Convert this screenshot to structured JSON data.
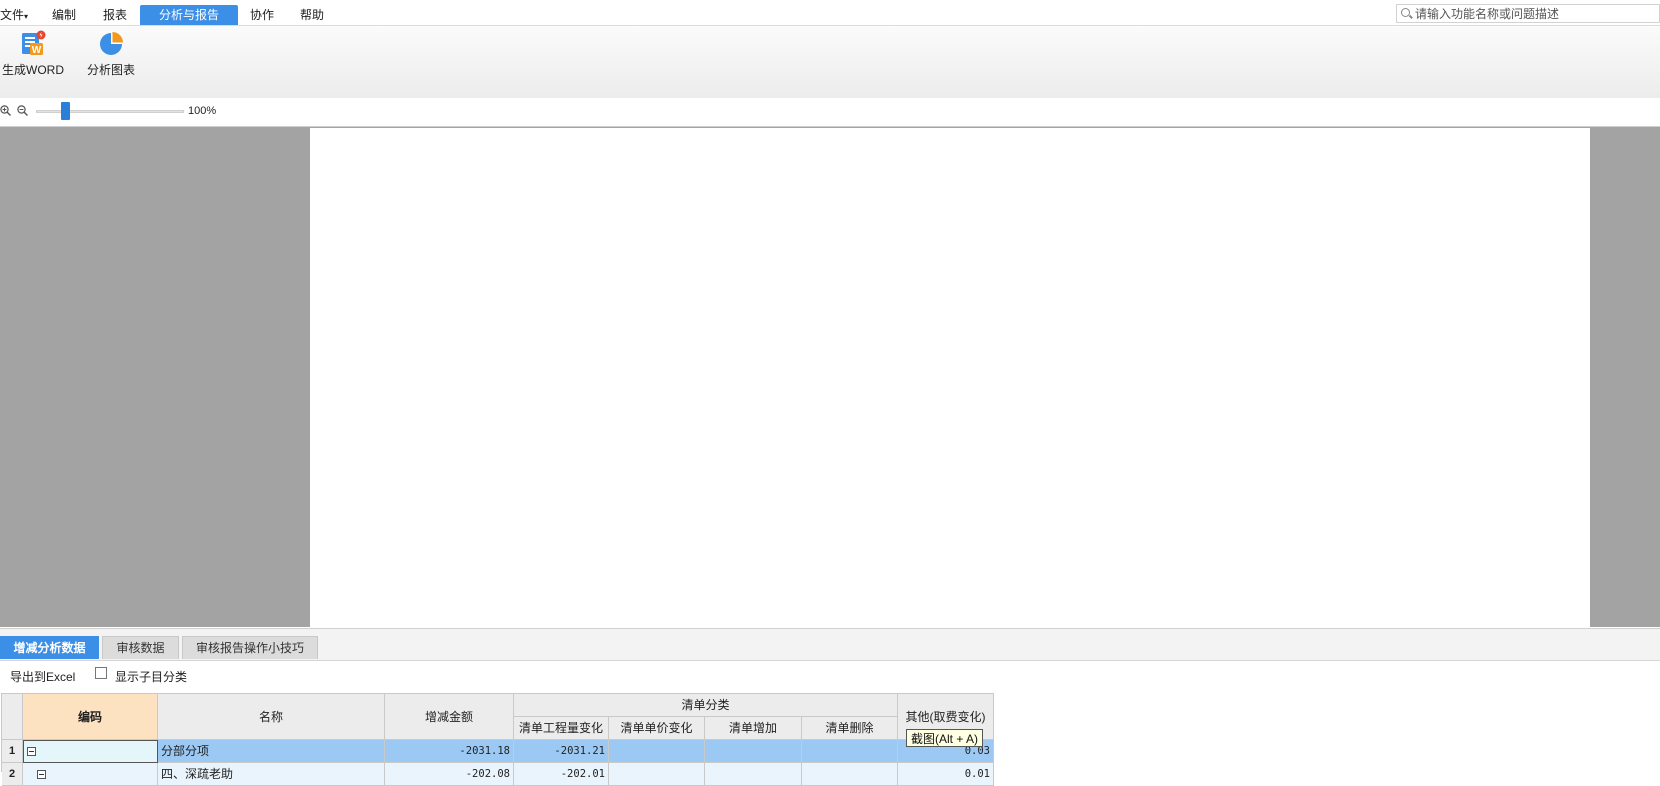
{
  "menu": {
    "file": "文件",
    "edit": "编制",
    "report": "报表",
    "analysis": "分析与报告",
    "collab": "协作",
    "help": "帮助"
  },
  "search": {
    "placeholder": "请输入功能名称或问题描述"
  },
  "ribbon": {
    "word": "生成WORD",
    "chart": "分析图表"
  },
  "zoom": {
    "value": "100%",
    "level_fraction": 0.2
  },
  "bottom_tabs": [
    "增减分析数据",
    "审核数据",
    "审核报告操作小技巧"
  ],
  "table_toolbar": {
    "export": "导出到Excel",
    "show_sub": "显示子目分类"
  },
  "table": {
    "headers": {
      "code": "编码",
      "name": "名称",
      "amount": "增减金额",
      "group": "清单分类",
      "qty_change": "清单工程量变化",
      "price_change": "清单单价变化",
      "added": "清单增加",
      "deleted": "清单删除",
      "other": "其他(取费变化)"
    },
    "rows": [
      {
        "num": "1",
        "name": "分部分项",
        "amount": "-2031.18",
        "qty_change": "-2031.21",
        "other": "0.03"
      },
      {
        "num": "2",
        "name": "四、深疏老助",
        "amount": "-202.08",
        "qty_change": "-202.01",
        "other": "0.01"
      }
    ]
  },
  "tooltip": "截图(Alt + A)",
  "colors": {
    "accent": "#3b8fe6",
    "preview_bg": "#a3a3a3",
    "row_selected": "#9cc9f4"
  }
}
